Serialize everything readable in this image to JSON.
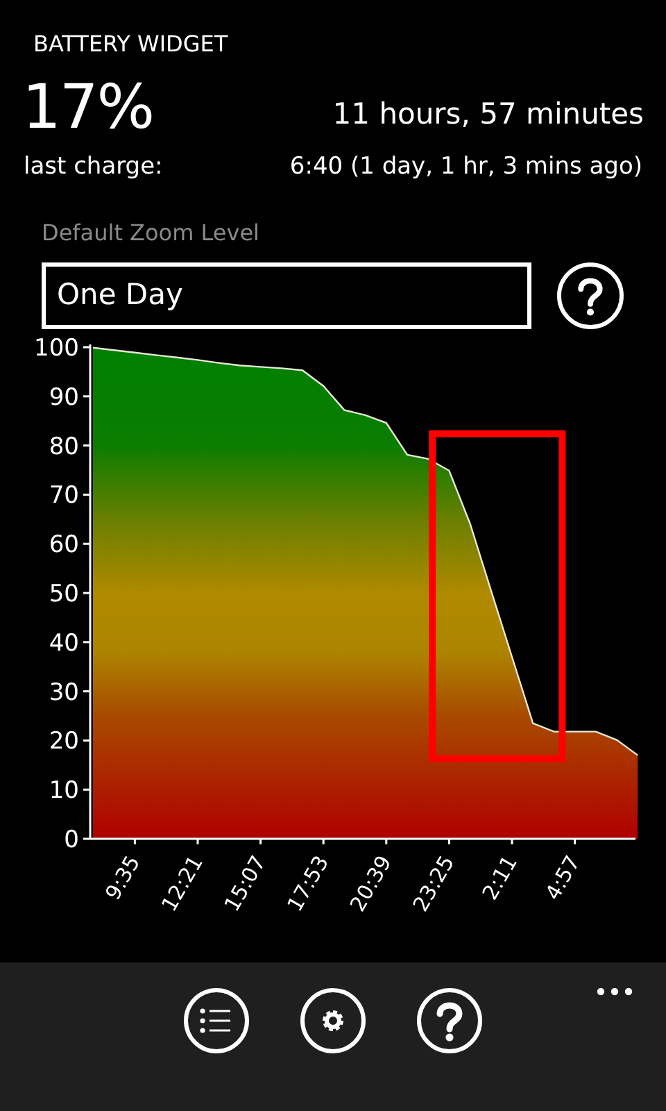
{
  "app_title": "BATTERY WIDGET",
  "battery": {
    "percent": "17%",
    "remaining": "11 hours, 57 minutes"
  },
  "last_charge": {
    "label": "last charge:",
    "value": "6:40 (1 day, 1 hr, 3 mins ago)"
  },
  "zoom_level": {
    "label": "Default Zoom Level",
    "value": "One Day"
  },
  "chart_data": {
    "type": "area",
    "categories": [
      null,
      null,
      "9:35",
      null,
      null,
      "12:21",
      null,
      null,
      "15:07",
      null,
      null,
      "17:53",
      null,
      null,
      "20:39",
      null,
      null,
      "23:25",
      null,
      null,
      "2:11",
      null,
      null,
      "4:57",
      null,
      null,
      null
    ],
    "series": [
      {
        "color": "#e8e8d8",
        "values": [
          99.9,
          99.4,
          98.9,
          98.4,
          97.9,
          97.4,
          96.8,
          96.3,
          96.0,
          95.7,
          95.3,
          92.1,
          87.2,
          86.2,
          84.6,
          78.1,
          77.3,
          74.9,
          64.1,
          50.5,
          37.0,
          23.5,
          21.8,
          21.8,
          21.8,
          20.1,
          17
        ]
      }
    ],
    "ylim": [
      0,
      100
    ],
    "yticks": [
      0,
      10,
      20,
      30,
      40,
      50,
      60,
      70,
      80,
      90,
      100
    ]
  },
  "highlight_box": {
    "color": "#ff0000"
  }
}
